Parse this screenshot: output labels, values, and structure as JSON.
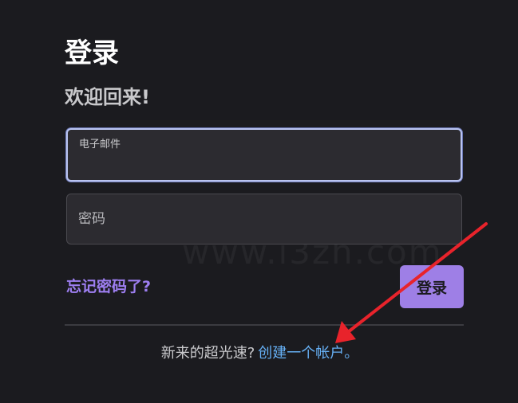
{
  "login": {
    "title": "登录",
    "subtitle": "欢迎回来!",
    "email_label": "电子邮件",
    "email_value": "",
    "password_placeholder": "密码",
    "forgot_label": "忘记密码了?",
    "submit_label": "登录"
  },
  "signup": {
    "prompt": "新来的超光速?",
    "link_label": "创建一个帐户",
    "suffix": "。"
  },
  "colors": {
    "background": "#1b1b1f",
    "accent_purple": "#9e7fe6",
    "link_blue": "#66b0f5",
    "annotation_arrow": "#e8232b"
  }
}
